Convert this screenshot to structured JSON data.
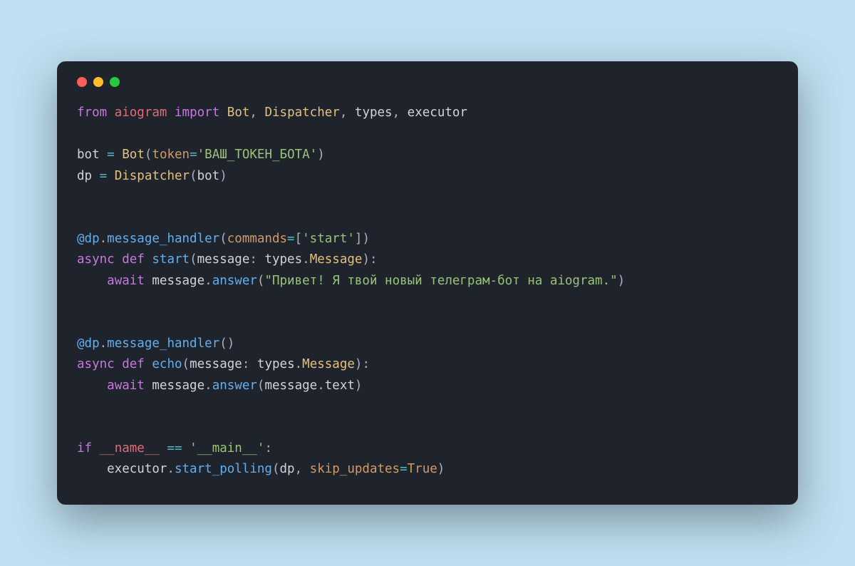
{
  "code": {
    "tokens": [
      [
        {
          "c": "kw",
          "t": "from"
        },
        {
          "c": "id",
          "t": " "
        },
        {
          "c": "pkg",
          "t": "aiogram"
        },
        {
          "c": "id",
          "t": " "
        },
        {
          "c": "kw",
          "t": "import"
        },
        {
          "c": "id",
          "t": " "
        },
        {
          "c": "cls",
          "t": "Bot"
        },
        {
          "c": "pun",
          "t": ", "
        },
        {
          "c": "cls",
          "t": "Dispatcher"
        },
        {
          "c": "pun",
          "t": ", "
        },
        {
          "c": "id",
          "t": "types"
        },
        {
          "c": "pun",
          "t": ", "
        },
        {
          "c": "id",
          "t": "executor"
        }
      ],
      [],
      [
        {
          "c": "id",
          "t": "bot "
        },
        {
          "c": "op",
          "t": "="
        },
        {
          "c": "id",
          "t": " "
        },
        {
          "c": "cls",
          "t": "Bot"
        },
        {
          "c": "pun",
          "t": "("
        },
        {
          "c": "prm",
          "t": "token"
        },
        {
          "c": "op",
          "t": "="
        },
        {
          "c": "str",
          "t": "'ВАШ_ТОКЕН_БОТА'"
        },
        {
          "c": "pun",
          "t": ")"
        }
      ],
      [
        {
          "c": "id",
          "t": "dp "
        },
        {
          "c": "op",
          "t": "="
        },
        {
          "c": "id",
          "t": " "
        },
        {
          "c": "cls",
          "t": "Dispatcher"
        },
        {
          "c": "pun",
          "t": "("
        },
        {
          "c": "id",
          "t": "bot"
        },
        {
          "c": "pun",
          "t": ")"
        }
      ],
      [],
      [],
      [
        {
          "c": "at",
          "t": "@dp"
        },
        {
          "c": "pun",
          "t": "."
        },
        {
          "c": "fn",
          "t": "message_handler"
        },
        {
          "c": "pun",
          "t": "("
        },
        {
          "c": "prm",
          "t": "commands"
        },
        {
          "c": "op",
          "t": "="
        },
        {
          "c": "pun",
          "t": "["
        },
        {
          "c": "str",
          "t": "'start'"
        },
        {
          "c": "pun",
          "t": "])"
        }
      ],
      [
        {
          "c": "kw",
          "t": "async def"
        },
        {
          "c": "id",
          "t": " "
        },
        {
          "c": "fn",
          "t": "start"
        },
        {
          "c": "pun",
          "t": "("
        },
        {
          "c": "id",
          "t": "message"
        },
        {
          "c": "pun",
          "t": ": "
        },
        {
          "c": "id",
          "t": "types"
        },
        {
          "c": "pun",
          "t": "."
        },
        {
          "c": "cls",
          "t": "Message"
        },
        {
          "c": "pun",
          "t": "):"
        }
      ],
      [
        {
          "c": "id",
          "t": "    "
        },
        {
          "c": "kw",
          "t": "await"
        },
        {
          "c": "id",
          "t": " message"
        },
        {
          "c": "pun",
          "t": "."
        },
        {
          "c": "fn",
          "t": "answer"
        },
        {
          "c": "pun",
          "t": "("
        },
        {
          "c": "str",
          "t": "\"Привет! Я твой новый телеграм-бот на aiogram.\""
        },
        {
          "c": "pun",
          "t": ")"
        }
      ],
      [],
      [],
      [
        {
          "c": "at",
          "t": "@dp"
        },
        {
          "c": "pun",
          "t": "."
        },
        {
          "c": "fn",
          "t": "message_handler"
        },
        {
          "c": "pun",
          "t": "()"
        }
      ],
      [
        {
          "c": "kw",
          "t": "async def"
        },
        {
          "c": "id",
          "t": " "
        },
        {
          "c": "fn",
          "t": "echo"
        },
        {
          "c": "pun",
          "t": "("
        },
        {
          "c": "id",
          "t": "message"
        },
        {
          "c": "pun",
          "t": ": "
        },
        {
          "c": "id",
          "t": "types"
        },
        {
          "c": "pun",
          "t": "."
        },
        {
          "c": "cls",
          "t": "Message"
        },
        {
          "c": "pun",
          "t": "):"
        }
      ],
      [
        {
          "c": "id",
          "t": "    "
        },
        {
          "c": "kw",
          "t": "await"
        },
        {
          "c": "id",
          "t": " message"
        },
        {
          "c": "pun",
          "t": "."
        },
        {
          "c": "fn",
          "t": "answer"
        },
        {
          "c": "pun",
          "t": "("
        },
        {
          "c": "id",
          "t": "message"
        },
        {
          "c": "pun",
          "t": "."
        },
        {
          "c": "id",
          "t": "text"
        },
        {
          "c": "pun",
          "t": ")"
        }
      ],
      [],
      [],
      [
        {
          "c": "kw",
          "t": "if"
        },
        {
          "c": "id",
          "t": " "
        },
        {
          "c": "dund",
          "t": "__name__"
        },
        {
          "c": "id",
          "t": " "
        },
        {
          "c": "op",
          "t": "=="
        },
        {
          "c": "id",
          "t": " "
        },
        {
          "c": "str",
          "t": "'__main__'"
        },
        {
          "c": "pun",
          "t": ":"
        }
      ],
      [
        {
          "c": "id",
          "t": "    executor"
        },
        {
          "c": "pun",
          "t": "."
        },
        {
          "c": "fn",
          "t": "start_polling"
        },
        {
          "c": "pun",
          "t": "("
        },
        {
          "c": "id",
          "t": "dp"
        },
        {
          "c": "pun",
          "t": ", "
        },
        {
          "c": "prm",
          "t": "skip_updates"
        },
        {
          "c": "op",
          "t": "="
        },
        {
          "c": "bool",
          "t": "True"
        },
        {
          "c": "pun",
          "t": ")"
        }
      ]
    ]
  }
}
